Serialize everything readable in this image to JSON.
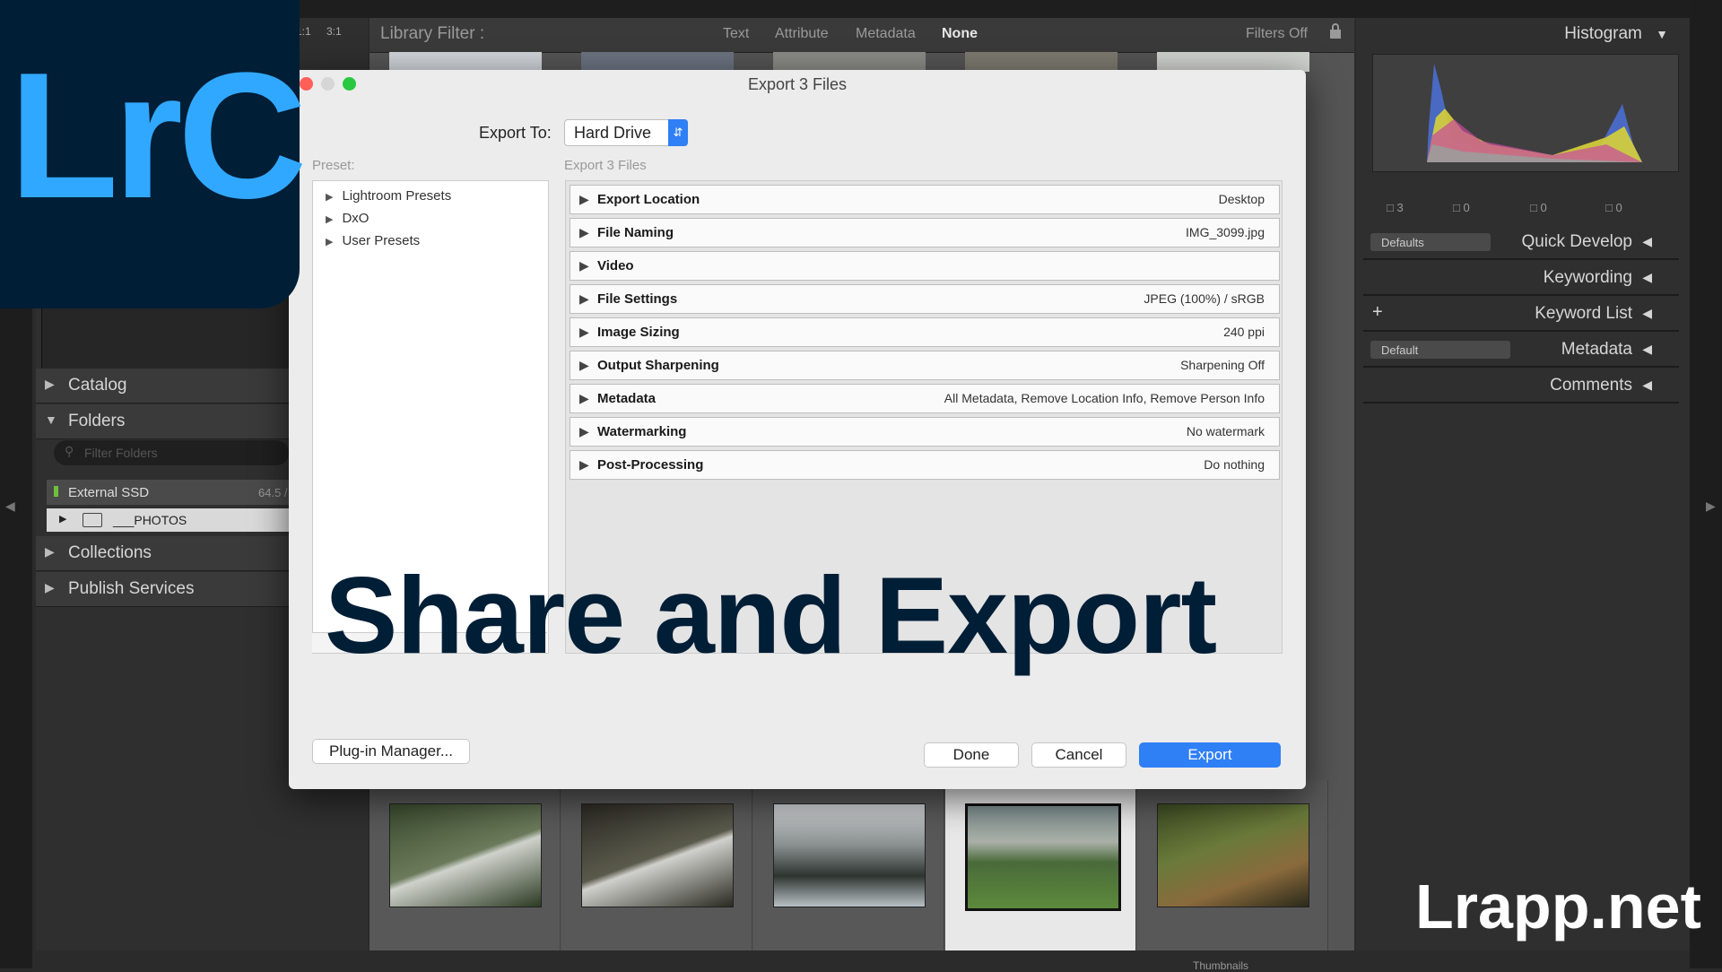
{
  "lightroom": {
    "zoom": [
      "1:1",
      "3:1"
    ],
    "library_filter": {
      "label": "Library Filter :",
      "tabs": [
        "Text",
        "Attribute",
        "Metadata",
        "None"
      ],
      "active_tab": "None",
      "filters_state": "Filters Off"
    },
    "left_panel": {
      "catalog": "Catalog",
      "folders": "Folders",
      "filter_placeholder": "Filter Folders",
      "drive_name": "External SSD",
      "drive_size": "64.5 /",
      "folder_name": "___PHOTOS",
      "collections": "Collections",
      "publish_services": "Publish Services"
    },
    "right_panel": {
      "histogram": "Histogram",
      "counts": [
        "3",
        "0",
        "0",
        "0"
      ],
      "quick_develop": "Quick Develop",
      "quick_develop_preset": "Defaults",
      "keywording": "Keywording",
      "keyword_list": "Keyword List",
      "metadata": "Metadata",
      "metadata_preset": "Default",
      "comments": "Comments"
    },
    "filmstrip_label": "Thumbnails"
  },
  "logo": {
    "text": "LrC",
    "bg_color": "#001e36",
    "fg_color": "#31a8ff"
  },
  "dialog": {
    "title": "Export 3 Files",
    "export_to_label": "Export To:",
    "export_to_value": "Hard Drive",
    "preset_label": "Preset:",
    "export_files_label": "Export 3 Files",
    "presets": [
      "Lightroom Presets",
      "DxO",
      "User Presets"
    ],
    "sections": [
      {
        "name": "Export Location",
        "value": "Desktop"
      },
      {
        "name": "File Naming",
        "value": "IMG_3099.jpg"
      },
      {
        "name": "Video",
        "value": ""
      },
      {
        "name": "File Settings",
        "value": "JPEG (100%) / sRGB"
      },
      {
        "name": "Image Sizing",
        "value": "240 ppi"
      },
      {
        "name": "Output Sharpening",
        "value": "Sharpening Off"
      },
      {
        "name": "Metadata",
        "value": "All Metadata, Remove Location Info, Remove Person Info"
      },
      {
        "name": "Watermarking",
        "value": "No watermark"
      },
      {
        "name": "Post-Processing",
        "value": "Do nothing"
      }
    ],
    "plugin_manager": "Plug-in Manager...",
    "done": "Done",
    "cancel": "Cancel",
    "export": "Export",
    "accent_color": "#2f7ff5"
  },
  "headline": "Share and Export",
  "watermark": "Lrapp.net"
}
